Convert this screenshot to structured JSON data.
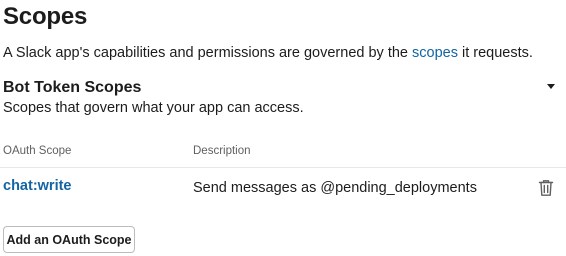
{
  "header": {
    "title": "Scopes",
    "intro_before": "A Slack app's capabilities and permissions are governed by the ",
    "intro_link": "scopes",
    "intro_after": " it requests."
  },
  "bot_token_scopes": {
    "title": "Bot Token Scopes",
    "description": "Scopes that govern what your app can access.",
    "expanded": true,
    "columns": {
      "scope": "OAuth Scope",
      "description": "Description"
    },
    "rows": [
      {
        "scope": "chat:write",
        "description": "Send messages as @pending_deployments",
        "action_icon": "trash-icon"
      }
    ],
    "add_button_label": "Add an OAuth Scope"
  },
  "colors": {
    "text": "#1d1c1d",
    "link": "#1264a3",
    "muted": "#616061",
    "divider": "#e8e8e8",
    "button_border": "#bcbcbc"
  }
}
